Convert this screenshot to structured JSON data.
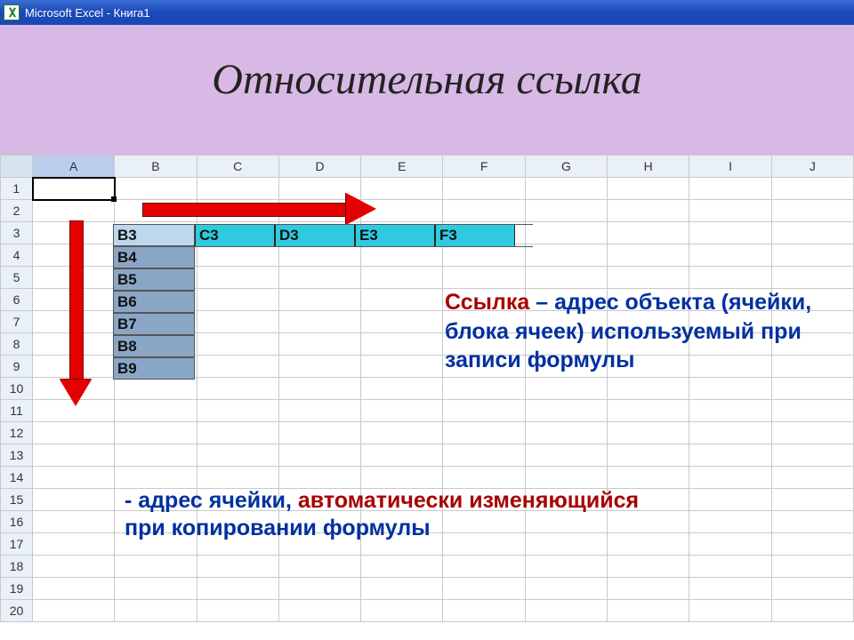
{
  "titlebar": {
    "app": "Microsoft Excel - Книга1"
  },
  "slide": {
    "title": "Относительная ссылка"
  },
  "sheet": {
    "columns": [
      "A",
      "B",
      "C",
      "D",
      "E",
      "F",
      "G",
      "H",
      "I",
      "J"
    ],
    "rows": [
      "1",
      "2",
      "3",
      "4",
      "5",
      "6",
      "7",
      "8",
      "9",
      "10",
      "11",
      "12",
      "13",
      "14",
      "15",
      "16",
      "17",
      "18",
      "19",
      "20"
    ]
  },
  "diagram": {
    "vertical_cells": [
      "B3",
      "B4",
      "B5",
      "B6",
      "B7",
      "B8",
      "B9"
    ],
    "horizontal_cells": [
      "C3",
      "D3",
      "E3",
      "F3"
    ]
  },
  "definition1": {
    "word": "Ссылка",
    "dash": " – ",
    "t1": "адрес объекта (ячейки, блока ячеек) используемый при записи формулы"
  },
  "definition2": {
    "dash": "- ",
    "t1": "адрес ячейки, ",
    "t2": "автоматически изменяющийся ",
    "t3": "при копировании формулы"
  }
}
